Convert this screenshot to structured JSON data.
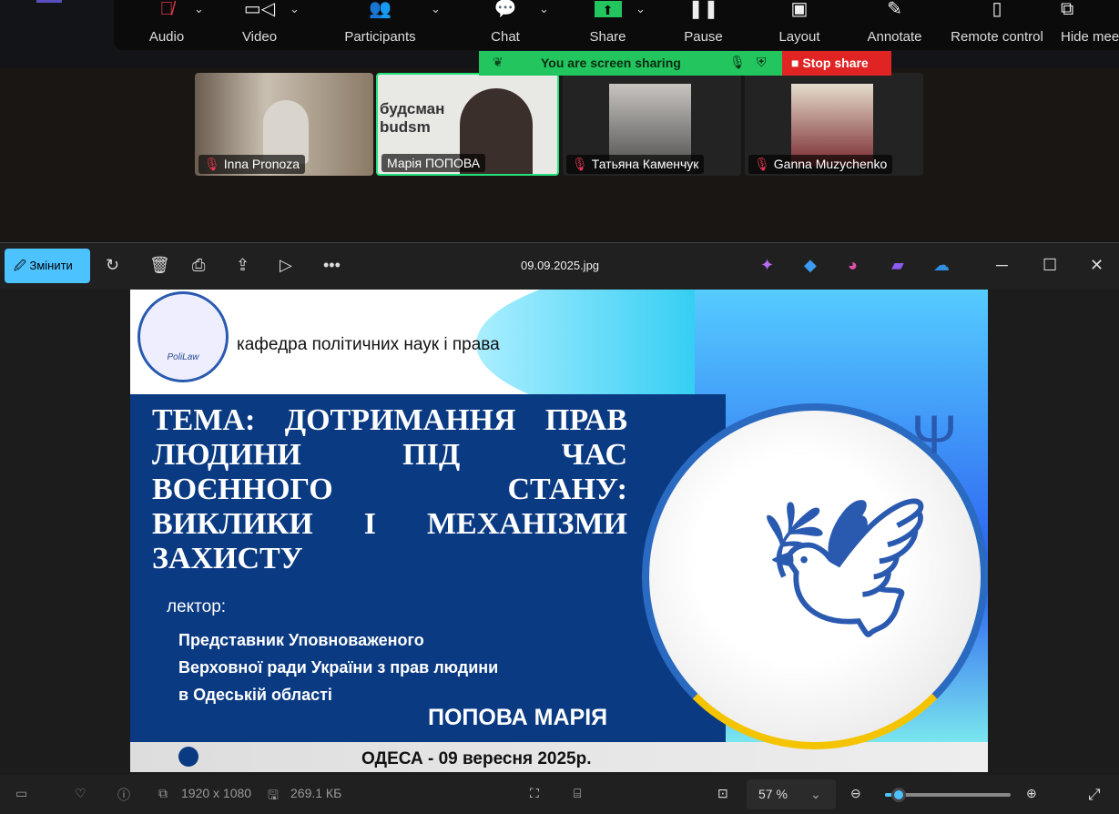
{
  "zoom_toolbar": {
    "buttons": [
      {
        "label": "Audio"
      },
      {
        "label": "Video"
      },
      {
        "label": "Participants"
      },
      {
        "label": "Chat"
      },
      {
        "label": "Share"
      },
      {
        "label": "Pause"
      },
      {
        "label": "Layout"
      },
      {
        "label": "Annotate"
      },
      {
        "label": "Remote control"
      },
      {
        "label": "Hide mee"
      }
    ]
  },
  "share_banner": {
    "text": "You are screen sharing",
    "stop_label": "Stop share",
    "accent": "#22c55e",
    "stop_color": "#e02424"
  },
  "participants": [
    {
      "name": "Inna Pronoza"
    },
    {
      "name": "Марія ПОПОВА"
    },
    {
      "name": "Татьяна Каменчук"
    },
    {
      "name": "Ganna Muzychenko"
    }
  ],
  "photos": {
    "edit_label": "Змінити",
    "file_name": "09.09.2025.jpg",
    "dimensions": "1920 x 1080",
    "file_size": "269.1 КБ",
    "zoom": "57 %",
    "zoom_fraction": 0.05
  },
  "slide": {
    "department": "кафедра політичних наук і права",
    "logo_text": "PoliLaw",
    "title": "ТЕМА: ДОТРИМАННЯ ПРАВ ЛЮДИНИ ПІД ЧАС ВОЄННОГО СТАНУ: ВИКЛИКИ І МЕХАНІЗМИ ЗАХИСТУ",
    "lecturer_label": "лектор:",
    "lecturer_lines": [
      "Представник Уповноваженого",
      "Верховної ради України  з прав людини",
      "в Одеській області"
    ],
    "lecturer_name": "ПОПОВА МАРІЯ",
    "footer": "ОДЕСА - 09 вересня 2025р.",
    "thumb_text": "будсман budsm"
  }
}
